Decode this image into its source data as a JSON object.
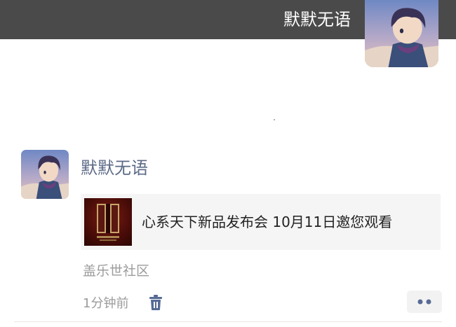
{
  "topbar": {
    "name": "默默无语",
    "avatar_icon": "user-avatar-icon"
  },
  "post": {
    "author": "默默无语",
    "avatar_icon": "user-avatar-icon",
    "link": {
      "title": "心系天下新品发布会 10月11日邀您观看",
      "thumbnail_icon": "event-poster-thumbnail"
    },
    "source": "盖乐世社区",
    "time": "1分钟前",
    "delete_icon": "trash-icon",
    "more_icon": "more-dots-icon"
  },
  "colors": {
    "topbar_bg": "#4a4a4a",
    "author_name": "#5c6a87",
    "meta_text": "#9b9b9b",
    "card_bg": "#f5f5f5",
    "icon_blue": "#576b95"
  }
}
